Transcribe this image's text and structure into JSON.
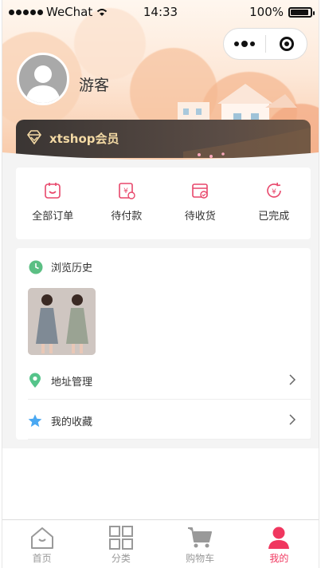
{
  "status_bar": {
    "carrier": "WeChat",
    "time": "14:33",
    "battery": "100%",
    "battery_level": 1.0
  },
  "user": {
    "name": "游客"
  },
  "member": {
    "label": "xtshop会员"
  },
  "orders": [
    {
      "label": "全部订单",
      "icon": "order-all-icon"
    },
    {
      "label": "待付款",
      "icon": "pending-payment-icon"
    },
    {
      "label": "待收货",
      "icon": "pending-receipt-icon"
    },
    {
      "label": "已完成",
      "icon": "completed-icon"
    }
  ],
  "history": {
    "title": "浏览历史"
  },
  "menu": {
    "address": "地址管理",
    "favorites": "我的收藏"
  },
  "tabs": [
    {
      "label": "首页",
      "icon": "home-icon"
    },
    {
      "label": "分类",
      "icon": "category-icon"
    },
    {
      "label": "购物车",
      "icon": "cart-icon"
    },
    {
      "label": "我的",
      "icon": "profile-icon"
    }
  ],
  "colors": {
    "accent": "#f0375f",
    "order_icon": "#e8476b",
    "member_text": "#f3d9a4",
    "history_icon": "#5cbf84",
    "address_icon": "#55c48a",
    "favorite_icon": "#4aa8f2",
    "tab_inactive": "#999999"
  }
}
